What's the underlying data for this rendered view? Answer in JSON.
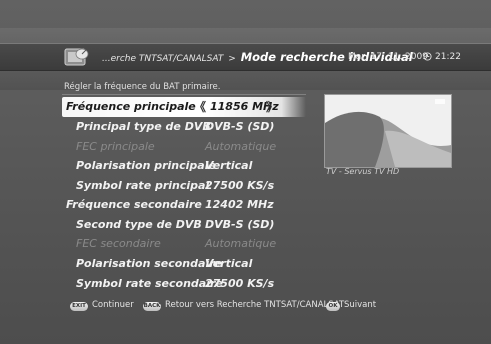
{
  "header": {
    "breadcrumb_prefix": "...erche TNTSAT/CANALSAT",
    "breadcrumb_separator": ">",
    "title": "Mode recherche individual",
    "date": "Mar, 17. 11. 2009",
    "time": "21:22",
    "clock_icon": "clock-icon",
    "app_icon": "satellite-dish-icon"
  },
  "instruction": "Régler la fréquence du BAT primaire.",
  "settings": [
    {
      "label": "Fréquence principale",
      "value": "11856 MHz",
      "state": "selected"
    },
    {
      "label": "Principal type de DVB",
      "value": "DVB-S (SD)",
      "state": "normal"
    },
    {
      "label": "FEC principale",
      "value": "Automatique",
      "state": "disabled"
    },
    {
      "label": "Polarisation principale",
      "value": "Vertical",
      "state": "normal"
    },
    {
      "label": "Symbol rate principal",
      "value": "27500 KS/s",
      "state": "normal"
    },
    {
      "label": "Fréquence secondaire",
      "value": "12402 MHz",
      "state": "normal"
    },
    {
      "label": "Second type de DVB",
      "value": "DVB-S (SD)",
      "state": "normal"
    },
    {
      "label": "FEC secondaire",
      "value": "Automatique",
      "state": "disabled"
    },
    {
      "label": "Polarisation secondaire",
      "value": "Vertical",
      "state": "normal"
    },
    {
      "label": "Symbol rate secondaire",
      "value": "27500 KS/s",
      "state": "normal"
    }
  ],
  "preview": {
    "caption": "TV - Servus TV HD"
  },
  "footer": {
    "exit_key": "EXIT",
    "exit_label": "Continuer",
    "back_key": "BACK",
    "back_label": "Retour vers Recherche TNTSAT/CANALSAT",
    "ok_key": "OK",
    "ok_label": "Suivant"
  },
  "colors": {
    "background": "#5c5c5c",
    "highlight": "#ffffff",
    "text": "#f2f2f2",
    "disabled_text": "#8a8a8a"
  }
}
